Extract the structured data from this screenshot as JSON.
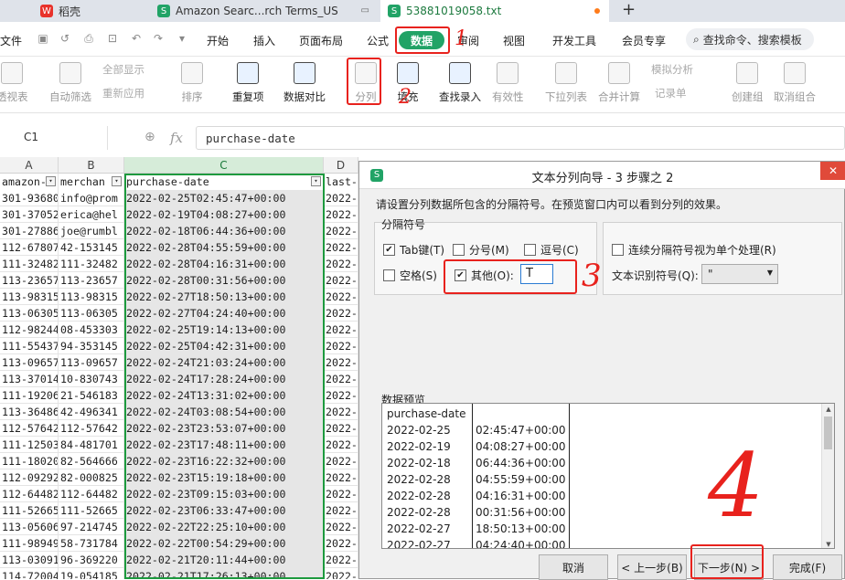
{
  "tabs": [
    {
      "label": "稻壳",
      "icon": "docer-icon"
    },
    {
      "label": "Amazon Searc...rch Terms_US",
      "icon": "sheet-icon"
    },
    {
      "label": "53881019058.txt",
      "icon": "sheet-icon"
    }
  ],
  "menu": {
    "file": "文件",
    "items": [
      "开始",
      "插入",
      "页面布局",
      "公式",
      "数据",
      "审阅",
      "视图",
      "开发工具",
      "会员专享"
    ],
    "active": "数据",
    "search": "查找命令、搜索模板"
  },
  "ribbon": {
    "buttons": [
      "透视表",
      "自动筛选",
      "排序",
      "重复项",
      "数据对比",
      "分列",
      "填充",
      "查找录入",
      "有效性",
      "下拉列表",
      "合并计算",
      "创建组",
      "取消组合"
    ],
    "small": [
      "全部显示",
      "重新应用",
      "模拟分析",
      "记录单"
    ]
  },
  "formula_bar": {
    "cell_ref": "C1",
    "fx": "fx",
    "content": "purchase-date"
  },
  "sheet": {
    "columns": [
      "A",
      "B",
      "C",
      "D"
    ],
    "header_row": [
      "amazon-",
      "merchan",
      "purchase-date",
      "last-"
    ],
    "rows": [
      [
        "301-93680",
        "info@prom",
        "2022-02-25T02:45:47+00:00",
        "2022-"
      ],
      [
        "301-37052",
        "erica@hel",
        "2022-02-19T04:08:27+00:00",
        "2022-"
      ],
      [
        "301-27886",
        "joe@rumbl",
        "2022-02-18T06:44:36+00:00",
        "2022-"
      ],
      [
        "112-67807",
        "42-153145",
        "2022-02-28T04:55:59+00:00",
        "2022-"
      ],
      [
        "111-32482",
        "111-32482",
        "2022-02-28T04:16:31+00:00",
        "2022-"
      ],
      [
        "113-23657",
        "113-23657",
        "2022-02-28T00:31:56+00:00",
        "2022-"
      ],
      [
        "113-98315",
        "113-98315",
        "2022-02-27T18:50:13+00:00",
        "2022-"
      ],
      [
        "113-06305",
        "113-06305",
        "2022-02-27T04:24:40+00:00",
        "2022-"
      ],
      [
        "112-98244",
        "08-453303",
        "2022-02-25T19:14:13+00:00",
        "2022-"
      ],
      [
        "111-55437",
        "94-353145",
        "2022-02-25T04:42:31+00:00",
        "2022-"
      ],
      [
        "113-09657",
        "113-09657",
        "2022-02-24T21:03:24+00:00",
        "2022-"
      ],
      [
        "113-37014",
        "10-830743",
        "2022-02-24T17:28:24+00:00",
        "2022-"
      ],
      [
        "111-19206",
        "21-546183",
        "2022-02-24T13:31:02+00:00",
        "2022-"
      ],
      [
        "113-36486",
        "42-496341",
        "2022-02-24T03:08:54+00:00",
        "2022-"
      ],
      [
        "112-57642",
        "112-57642",
        "2022-02-23T23:53:07+00:00",
        "2022-"
      ],
      [
        "111-12503",
        "84-481701",
        "2022-02-23T17:48:11+00:00",
        "2022-"
      ],
      [
        "111-18020",
        "82-564666",
        "2022-02-23T16:22:32+00:00",
        "2022-"
      ],
      [
        "112-09292",
        "82-000825",
        "2022-02-23T15:19:18+00:00",
        "2022-"
      ],
      [
        "112-64482",
        "112-64482",
        "2022-02-23T09:15:03+00:00",
        "2022-"
      ],
      [
        "111-52665",
        "111-52665",
        "2022-02-23T06:33:47+00:00",
        "2022-"
      ],
      [
        "113-05606",
        "97-214745",
        "2022-02-22T22:25:10+00:00",
        "2022-"
      ],
      [
        "111-98949",
        "58-731784",
        "2022-02-22T00:54:29+00:00",
        "2022-"
      ],
      [
        "113-03091",
        "96-369220",
        "2022-02-21T20:11:44+00:00",
        "2022-"
      ],
      [
        "114-72004",
        "19-054185",
        "2022-02-21T17:26:13+00:00",
        "2022-"
      ]
    ]
  },
  "dialog": {
    "title": "文本分列向导 - 3 步骤之 2",
    "instruction": "请设置分列数据所包含的分隔符号。在预览窗口内可以看到分列的效果。",
    "group_label": "分隔符号",
    "checks": {
      "tab": "Tab键(T)",
      "semicolon": "分号(M)",
      "comma": "逗号(C)",
      "space": "空格(S)",
      "other": "其他(O):",
      "consecutive": "连续分隔符号视为单个处理(R)"
    },
    "other_value": "T",
    "qualifier_label": "文本识别符号(Q):",
    "qualifier_value": "\"",
    "preview_label": "数据预览",
    "preview_rows": [
      [
        "purchase-date",
        ""
      ],
      [
        "2022-02-25",
        "02:45:47+00:00"
      ],
      [
        "2022-02-19",
        "04:08:27+00:00"
      ],
      [
        "2022-02-18",
        "06:44:36+00:00"
      ],
      [
        "2022-02-28",
        "04:55:59+00:00"
      ],
      [
        "2022-02-28",
        "04:16:31+00:00"
      ],
      [
        "2022-02-28",
        "00:31:56+00:00"
      ],
      [
        "2022-02-27",
        "18:50:13+00:00"
      ],
      [
        "2022-02-27",
        "04:24:40+00:00"
      ]
    ],
    "buttons": {
      "cancel": "取消",
      "back": "< 上一步(B)",
      "next": "下一步(N) >",
      "finish": "完成(F)"
    }
  },
  "annotations": [
    "1",
    "2",
    "3",
    "4"
  ],
  "colors": {
    "accent_green": "#21a366",
    "annotation_red": "#e8221d"
  }
}
